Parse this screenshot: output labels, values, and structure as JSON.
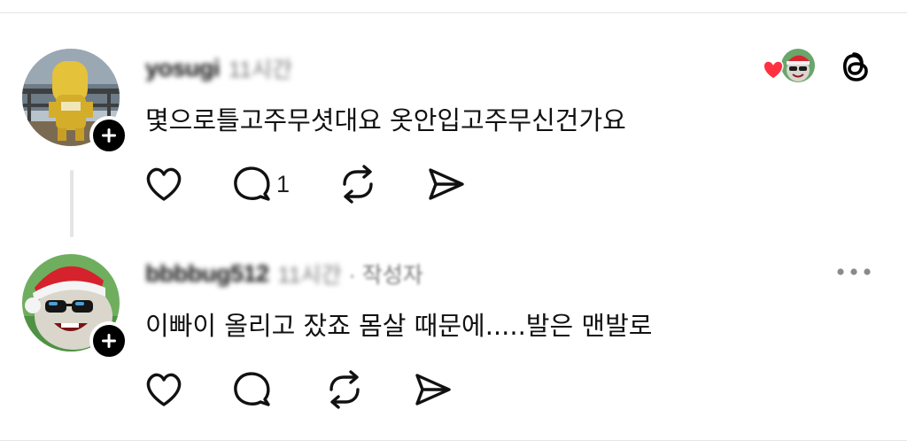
{
  "posts": [
    {
      "username": "yosugi",
      "timestamp": "11시간",
      "author_tag": "",
      "text": "몇으로틀고주무셧대요 옷안입고주무신건가요",
      "actions": {
        "like_count": "",
        "reply_count": "1",
        "repost_count": "",
        "share_count": ""
      }
    },
    {
      "username": "bbbbug512",
      "timestamp": "11시간",
      "author_tag": "· 작성자",
      "text": "이빠이 올리고 잤죠 몸살 때문에.....발은 맨발로",
      "actions": {
        "like_count": "",
        "reply_count": "",
        "repost_count": "",
        "share_count": ""
      }
    }
  ],
  "icons": {
    "like": "heart-icon",
    "reply": "speech-bubble-icon",
    "repost": "repost-icon",
    "share": "send-icon",
    "app": "threads-logo-icon",
    "more": "more-dots-icon",
    "follow": "plus-icon"
  },
  "colors": {
    "text": "#111111",
    "muted": "#777777",
    "liked_heart": "#ff3040",
    "divider": "#e5e5e5"
  }
}
